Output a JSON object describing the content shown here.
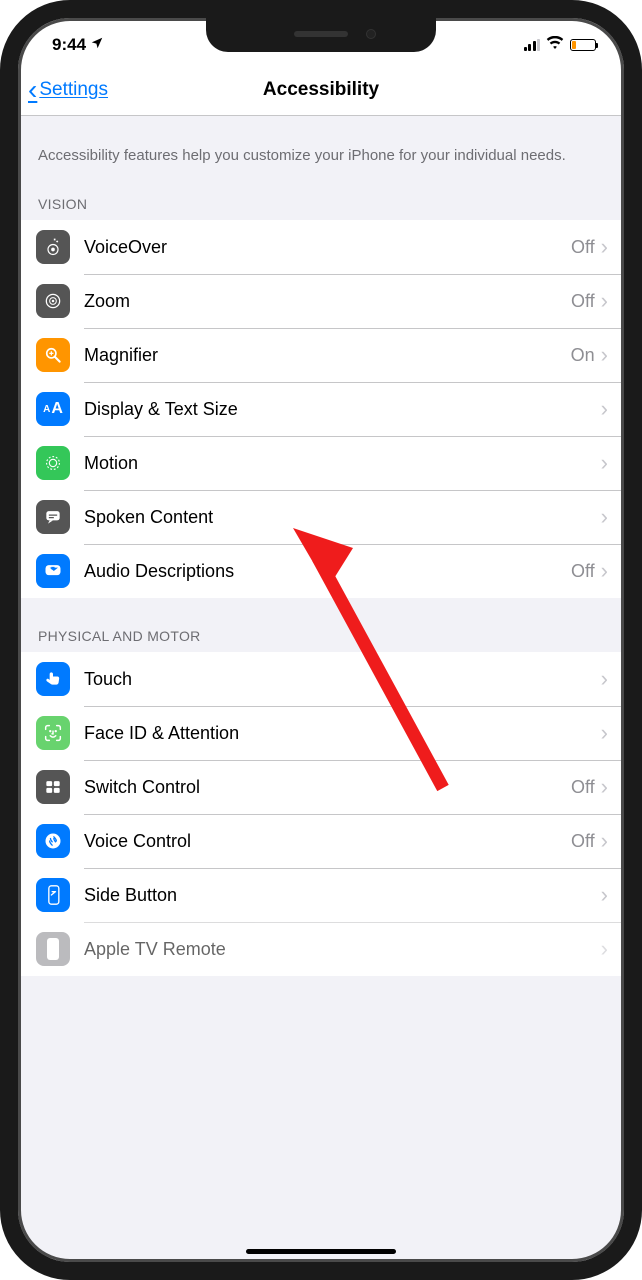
{
  "status": {
    "time": "9:44",
    "location_icon": "location-arrow"
  },
  "nav": {
    "back_label": "Settings",
    "title": "Accessibility"
  },
  "header_text": "Accessibility features help you customize your iPhone for your individual needs.",
  "sections": {
    "vision": {
      "title": "VISION",
      "items": [
        {
          "label": "VoiceOver",
          "value": "Off"
        },
        {
          "label": "Zoom",
          "value": "Off"
        },
        {
          "label": "Magnifier",
          "value": "On"
        },
        {
          "label": "Display & Text Size",
          "value": ""
        },
        {
          "label": "Motion",
          "value": ""
        },
        {
          "label": "Spoken Content",
          "value": ""
        },
        {
          "label": "Audio Descriptions",
          "value": "Off"
        }
      ]
    },
    "physical": {
      "title": "PHYSICAL AND MOTOR",
      "items": [
        {
          "label": "Touch",
          "value": ""
        },
        {
          "label": "Face ID & Attention",
          "value": ""
        },
        {
          "label": "Switch Control",
          "value": "Off"
        },
        {
          "label": "Voice Control",
          "value": "Off"
        },
        {
          "label": "Side Button",
          "value": ""
        },
        {
          "label": "Apple TV Remote",
          "value": ""
        }
      ]
    }
  }
}
